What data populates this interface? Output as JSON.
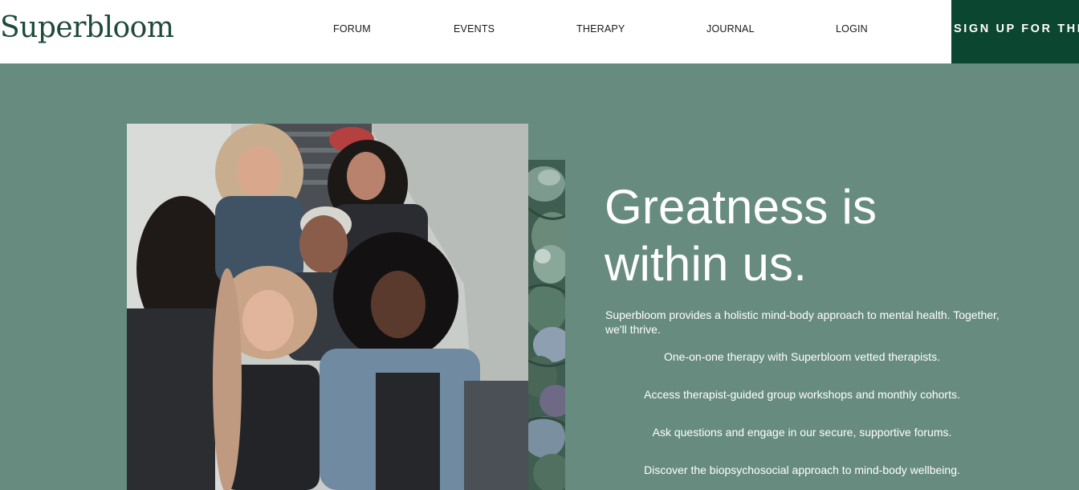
{
  "brand": {
    "logo_text": "Superbloom"
  },
  "nav": {
    "items": [
      {
        "label": "FORUM"
      },
      {
        "label": "EVENTS"
      },
      {
        "label": "THERAPY"
      },
      {
        "label": "JOURNAL"
      },
      {
        "label": "LOGIN"
      }
    ],
    "signup_label": "SIGN UP FOR THERAPY"
  },
  "hero": {
    "headline_line1": "Greatness is",
    "headline_line2": "within us.",
    "intro": "Superbloom provides a holistic mind-body approach to mental health. Together, we'll thrive.",
    "bullets": [
      "One-on-one therapy with Superbloom vetted therapists.",
      "Access therapist-guided group workshops and monthly cohorts.",
      "Ask questions and engage in our secure, supportive forums.",
      "Discover the biopsychosocial approach to mind-body wellbeing."
    ]
  },
  "colors": {
    "brand_dark_green": "#0b4630",
    "hero_background": "#678c7f",
    "logo_color": "#1f4a3a"
  },
  "images": {
    "group_photo": "group-of-women-photo",
    "side_image": "succulent-plant-photo"
  }
}
